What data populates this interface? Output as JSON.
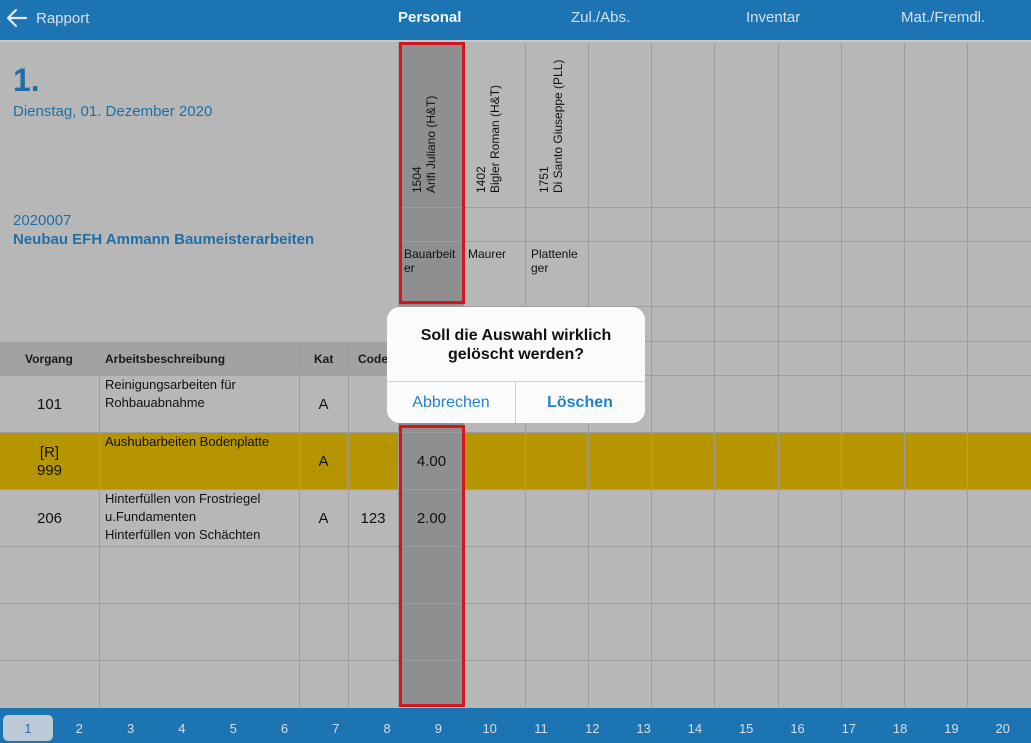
{
  "topbar": {
    "back_label": "Rapport",
    "tabs": [
      "Personal",
      "Zul./Abs.",
      "Inventar",
      "Mat./Fremdl."
    ],
    "active_tab": "Personal"
  },
  "header": {
    "day_number": "1.",
    "date": "Dienstag, 01. Dezember 2020",
    "project_number": "2020007",
    "project_name": "Neubau EFH Ammann Baumeisterarbeiten"
  },
  "columns": {
    "vorgang": "Vorgang",
    "beschreibung": "Arbeitsbeschreibung",
    "kat": "Kat",
    "code": "Code"
  },
  "persons": [
    {
      "number": "1504",
      "name": "Arifi Juliano (H&T)",
      "role": "Bauarbeiter",
      "role_lines": [
        "Bauarbeit",
        "er"
      ]
    },
    {
      "number": "1402",
      "name": "Bigler Roman (H&T)",
      "role": "Maurer",
      "role_lines": [
        "Maurer",
        ""
      ]
    },
    {
      "number": "1751",
      "name": "Di Santo Giuseppe (PLL)",
      "role": "Plattenleger",
      "role_lines": [
        "Plattenle",
        "ger"
      ]
    }
  ],
  "rows": [
    {
      "vorgang": "101",
      "vorgang_prefix": "",
      "lines": [
        "Reinigungsarbeiten für",
        "Rohbauabnahme",
        ""
      ],
      "kat": "A",
      "code": "",
      "hours": ""
    },
    {
      "vorgang": "999",
      "vorgang_prefix": "[R]",
      "lines": [
        "Aushubarbeiten Bodenplatte",
        "",
        ""
      ],
      "kat": "A",
      "code": "",
      "hours": "4.00"
    },
    {
      "vorgang": "206",
      "vorgang_prefix": "",
      "lines": [
        "Hinterfüllen von Frostriegel",
        "u.Fundamenten",
        "Hinterfüllen von Schächten"
      ],
      "kat": "A",
      "code": "123",
      "hours": "2.00"
    }
  ],
  "dialog": {
    "message_line1": "Soll die Auswahl wirklich",
    "message_line2": "gelöscht werden?",
    "cancel_label": "Abbrechen",
    "confirm_label": "Löschen"
  },
  "pager": {
    "pages": [
      "1",
      "2",
      "3",
      "4",
      "5",
      "6",
      "7",
      "8",
      "9",
      "10",
      "11",
      "12",
      "13",
      "14",
      "15",
      "16",
      "17",
      "18",
      "19",
      "20"
    ],
    "active": "1"
  },
  "colors": {
    "bar": "#1d74b3",
    "highlight_row": "#b69502",
    "selection_border": "#d3161c",
    "accent_text": "#1f6fa7"
  }
}
